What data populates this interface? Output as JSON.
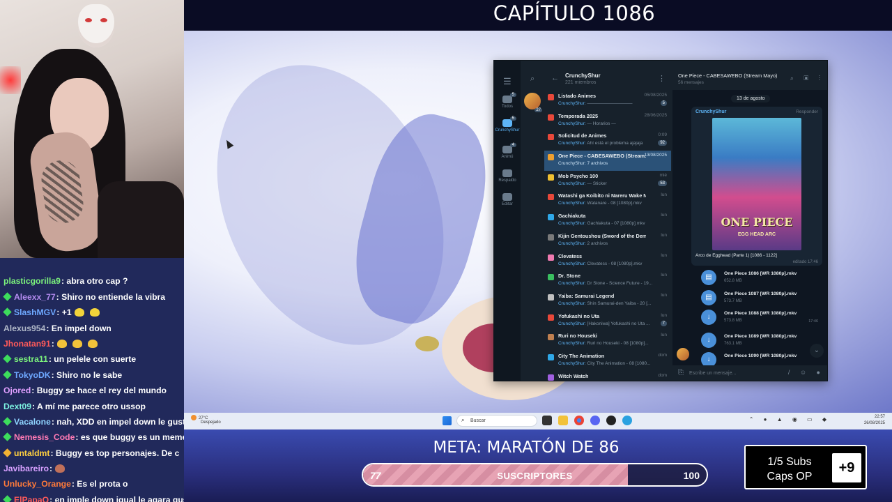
{
  "overlay": {
    "chapter_title": "CAPÍTULO 1086",
    "meta_title": "META: MARATÓN DE 86",
    "progress": {
      "current": "77",
      "label": "SUSCRIPTORES",
      "goal": "100",
      "fraction": 0.77
    },
    "subs_box": {
      "line1": "1/5 Subs",
      "line2": "Caps OP",
      "plus": "+9"
    }
  },
  "chat": [
    {
      "user": "",
      "text": "",
      "color": "#ffffff",
      "badge": ""
    },
    {
      "user": "plasticgorilla9",
      "text": ": abra otro cap ?",
      "color": "#7cf27c",
      "badge": ""
    },
    {
      "user": "Aleexx_77",
      "text": ": Shiro no entiende la vibra",
      "color": "#b48cf0",
      "badge": "#3ddc5c"
    },
    {
      "user": "SlashMGV",
      "text": ": +1",
      "color": "#6ea8ff",
      "badge": "#3ddc5c",
      "emotes": [
        "#f2d33a",
        "#f2d33a"
      ]
    },
    {
      "user": "Alexus954",
      "text": ": En impel down",
      "color": "#b0b8c8",
      "badge": ""
    },
    {
      "user": "Jhonatan91",
      "text": ":",
      "color": "#ff5a5a",
      "badge": "",
      "emotes": [
        "#f2c23a",
        "#f2c23a",
        "#f2c23a"
      ]
    },
    {
      "user": "sestra11",
      "text": ": un pelele con suerte",
      "color": "#7cf27c",
      "badge": "#3ddc5c"
    },
    {
      "user": "TokyoDK",
      "text": ": Shiro no le sabe",
      "color": "#6ea8ff",
      "badge": "#3ddc5c"
    },
    {
      "user": "Ojored",
      "text": ": Buggy se hace el rey del mundo",
      "color": "#e0a0ff",
      "badge": ""
    },
    {
      "user": "Dext09",
      "text": ": A mí me parece otro ussop",
      "color": "#7cf2e0",
      "badge": ""
    },
    {
      "user": "Vacalone",
      "text": ": nah, XDD en impel down le gusta",
      "color": "#8fd4ff",
      "badge": "#3ddc5c"
    },
    {
      "user": "Nemesis_Code",
      "text": ": es que buggy es un meme",
      "color": "#ff7ab4",
      "badge": "#3ddc5c"
    },
    {
      "user": "untaldmt",
      "text": ": Buggy es top personajes. De c",
      "color": "#ffd040",
      "badge": "#f2b233"
    },
    {
      "user": "Javibareiro",
      "text": ":",
      "color": "#d7a0ff",
      "badge": "",
      "emotes": [
        "#c0705a"
      ]
    },
    {
      "user": "Unlucky_Orange",
      "text": ": Es el prota o",
      "color": "#ff7a3a",
      "badge": ""
    },
    {
      "user": "ElPapaQ",
      "text": ": en imple down igual le agara gus",
      "color": "#ff5a5a",
      "badge": "#3ddc5c"
    }
  ],
  "telegram": {
    "rail": [
      {
        "label": "Todos",
        "count": "5"
      },
      {
        "label": "CrunchyShur",
        "count": "5"
      },
      {
        "label": "Animú",
        "count": "4"
      },
      {
        "label": "Respaldo",
        "count": ""
      },
      {
        "label": "Editar",
        "count": ""
      }
    ],
    "group_name": "CrunchyShur",
    "members": "221 miembros",
    "group_badge": "27",
    "topics": [
      {
        "title": "Listado Animes",
        "time": "05/08/2025",
        "sub_user": "CrunchyShur:",
        "sub_text": " ——————————",
        "badge": "5",
        "color": "#e8483a"
      },
      {
        "title": "Temporada 2025",
        "time": "28/06/2025",
        "sub_user": "CrunchyShur:",
        "sub_text": " — Horarios —",
        "badge": "",
        "color": "#e8483a"
      },
      {
        "title": "Solicitud de Animes",
        "time": "0:09",
        "sub_user": "CrunchyShur:",
        "sub_text": " Ahí está el problema ajajaja",
        "badge": "92",
        "color": "#e8483a"
      },
      {
        "title": "One Piece - CABESAWEBO (Stream...",
        "time": "13/08/2025",
        "sub_user": "CrunchyShur:",
        "sub_text": " 7 archivos",
        "badge": "",
        "color": "#f0a030",
        "selected": true
      },
      {
        "title": "Mob Psycho 100",
        "time": "mié",
        "sub_user": "CrunchyShur:",
        "sub_text": " — Sticker",
        "badge": "53",
        "color": "#f0c030"
      },
      {
        "title": "Watashi ga Koibito ni Nareru Wake Nai J...",
        "time": "lun",
        "sub_user": "CrunchyShur:",
        "sub_text": " Watanare - 08 [1080p].mkv",
        "badge": "",
        "color": "#e8483a"
      },
      {
        "title": "Gachiakuta",
        "time": "lun",
        "sub_user": "CrunchyShur:",
        "sub_text": " Gachiakuta - 07 [1080p].mkv",
        "badge": "",
        "color": "#2fa8e8"
      },
      {
        "title": "Kijin Gentoushou (Sword of the Demon H...",
        "time": "lun",
        "sub_user": "CrunchyShur:",
        "sub_text": " 2 archivos",
        "badge": "",
        "color": "#7a7a7a"
      },
      {
        "title": "Clevatess",
        "time": "lun",
        "sub_user": "CrunchyShur:",
        "sub_text": " Clevatess - 08 [1080p].mkv",
        "badge": "",
        "color": "#f07ab0"
      },
      {
        "title": "Dr. Stone",
        "time": "lun",
        "sub_user": "CrunchyShur:",
        "sub_text": " Dr Stone - Science Future - 19...",
        "badge": "",
        "color": "#3ac060"
      },
      {
        "title": "Yaiba: Samurai Legend",
        "time": "lun",
        "sub_user": "CrunchyShur:",
        "sub_text": " Shin Samurai-den Yaiba - 20 [...",
        "badge": "",
        "color": "#c0c0c0"
      },
      {
        "title": "Yofukashi no Uta",
        "time": "lun",
        "sub_user": "CrunchyShur:",
        "sub_text": " [Hakoniwa] Yofukashi no Uta ...",
        "badge": "7",
        "color": "#e8483a"
      },
      {
        "title": "Ruri no Houseki",
        "time": "lun",
        "sub_user": "CrunchyShur:",
        "sub_text": " Ruri no Houseki - 08 [1080p]...",
        "badge": "",
        "color": "#c08050"
      },
      {
        "title": "City The Animation",
        "time": "dom",
        "sub_user": "CrunchyShur:",
        "sub_text": " City The Animation - 08 [1080...",
        "badge": "",
        "color": "#2fa8e8"
      },
      {
        "title": "Witch Watch",
        "time": "dom",
        "sub_user": "",
        "sub_text": "",
        "badge": "",
        "color": "#a060e0"
      }
    ],
    "chat_title": "One Piece - CABESAWEBO (Stream Mayo)",
    "chat_count": "56 mensajes",
    "date_pill": "13 de agosto",
    "message": {
      "sender": "CrunchyShur",
      "reply": "Responder",
      "poster_logo": "ONE PIECE",
      "poster_arc": "EGG HEAD ARC",
      "caption": "Arco de Egghead (Parte 1) [1086 - 1122]",
      "edited": "editado 17:46"
    },
    "files": [
      {
        "name": "One Piece 1086 [WR 1080p].mkv",
        "size": "652.8 MB",
        "time": "",
        "icon": "file"
      },
      {
        "name": "One Piece 1087 [WR 1080p].mkv",
        "size": "573.7 MB",
        "time": "",
        "icon": "file"
      },
      {
        "name": "One Piece 1088 [WR 1080p].mkv",
        "size": "573.8 MB",
        "time": "17:46",
        "icon": "download"
      },
      {
        "name": "One Piece 1089 [WR 1080p].mkv",
        "size": "763.1 MB",
        "time": "",
        "icon": "download"
      },
      {
        "name": "One Piece 1090 [WR 1080p].mkv",
        "size": "",
        "time": "",
        "icon": "download"
      }
    ],
    "composer_placeholder": "Escribe un mensaje..."
  },
  "taskbar": {
    "weather_temp": "27°C",
    "weather_desc": "Despejado",
    "search_label": "Buscar",
    "time": "22:57",
    "date": "26/08/2025"
  }
}
